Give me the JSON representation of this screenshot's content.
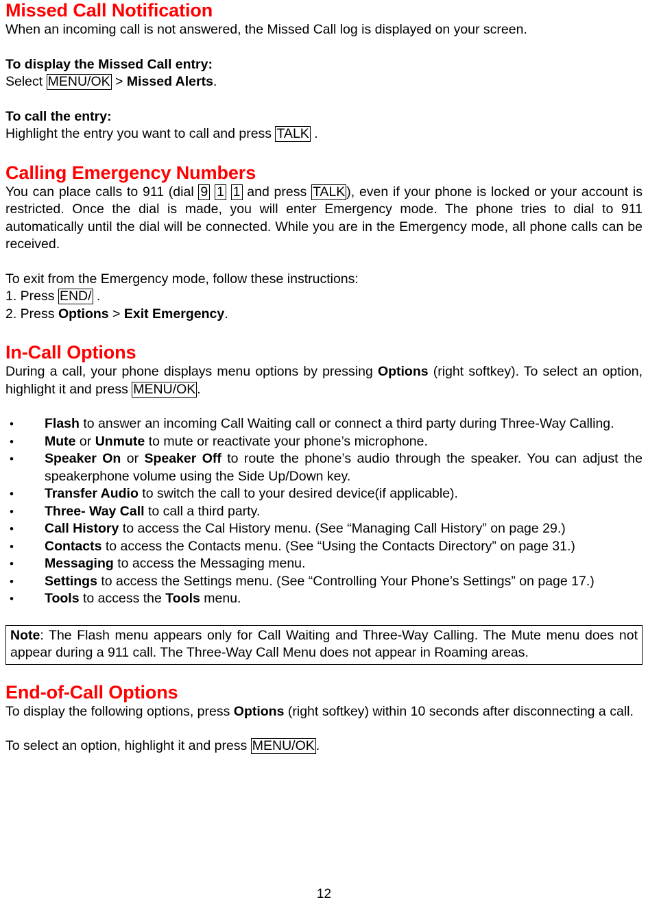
{
  "document": {
    "page_number": "12",
    "accent_color": "#FF0000",
    "text_color": "#000000",
    "background_color": "#FFFFFF"
  },
  "sections": {
    "missed_call": {
      "heading": "Missed Call Notification",
      "intro": "When an incoming call is not answered, the Missed Call log is displayed on your screen.",
      "display_entry": {
        "subheading": "To display the Missed Call entry:",
        "text_before": "Select ",
        "key": "MENU/OK",
        "text_middle": " > ",
        "bold_target": "Missed Alerts",
        "text_after": "."
      },
      "call_entry": {
        "subheading": "To call the entry:",
        "text_before": "Highlight the entry you want to call and press ",
        "key": "TALK",
        "text_after": " ."
      }
    },
    "emergency": {
      "heading": "Calling Emergency Numbers",
      "para_part1": "You can place calls to 911 (dial ",
      "key_9": "9",
      "key_1a": "1",
      "key_1b": "1",
      "para_part2": " and press ",
      "key_talk": "TALK",
      "para_part3": "), even if your phone is locked or your account is restricted. Once the dial is made, you will enter Emergency mode. The phone tries to dial to 911 automatically until the dial will be connected. While you are in the Emergency mode, all phone calls can be received.",
      "exit_intro": "To exit from the Emergency mode, follow these instructions:",
      "step1_before": "1. Press ",
      "step1_key": "END/",
      "step1_after": " .",
      "step2_before": "2. Press ",
      "step2_bold1": "Options",
      "step2_middle": " > ",
      "step2_bold2": "Exit Emergency",
      "step2_after": "."
    },
    "in_call": {
      "heading": "In-Call Options",
      "intro_part1": "During a call, your phone displays menu options by pressing ",
      "intro_bold": "Options",
      "intro_part2": " (right softkey). To select an option, highlight it and press ",
      "intro_key": "MENU/OK",
      "intro_part3": ".",
      "options": [
        {
          "bold": "Flash",
          "rest": " to answer an incoming Call Waiting call or connect a third party during Three-Way Calling."
        },
        {
          "bold": "Mute",
          "mid": " or ",
          "bold2": "Unmute",
          "rest": " to mute or reactivate your phone’s microphone."
        },
        {
          "bold": "Speaker On",
          "mid": " or ",
          "bold2": "Speaker Off",
          "rest": " to route the phone’s audio through the speaker. You can adjust the speakerphone volume using the Side Up/Down key."
        },
        {
          "bold": "Transfer  Audio",
          "rest": " to switch the call to your desired device(if applicable)."
        },
        {
          "bold": "Three- Way Call",
          "rest": " to call a third party."
        },
        {
          "bold": "Call History",
          "rest": " to access the Cal History menu. (See “Managing Call History” on page 29.)"
        },
        {
          "bold": "Contacts",
          "rest": " to access the Contacts menu. (See “Using the Contacts Directory” on page 31.)"
        },
        {
          "bold": "Messaging",
          "rest": " to access the Messaging menu."
        },
        {
          "bold": "Settings",
          "rest": " to access the Settings menu. (See “Controlling Your Phone’s Settings” on page 17.)"
        },
        {
          "bold": "Tools",
          "mid": " to access the ",
          "bold2": "Tools",
          "rest": " menu."
        }
      ],
      "note": {
        "label": "Note",
        "text": ": The Flash menu appears only for Call Waiting and Three-Way Calling. The Mute menu does not appear during a 911 call. The Three-Way Call Menu does not appear in Roaming areas."
      }
    },
    "end_of_call": {
      "heading": "End-of-Call Options",
      "para_part1": "To display the following options, press ",
      "para_bold": "Options",
      "para_part2": " (right softkey) within 10 seconds after disconnecting a call.",
      "select_before": "To select an option, highlight it and press ",
      "select_key": "MENU/OK",
      "select_after": "."
    }
  }
}
